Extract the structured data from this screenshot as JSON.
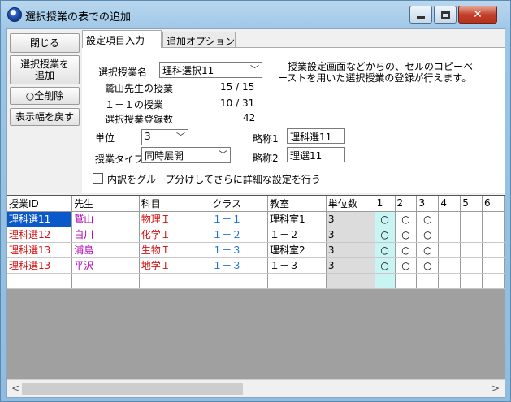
{
  "window": {
    "title": "選択授業の表での追加"
  },
  "left_buttons": {
    "close": "閉じる",
    "add_line1": "選択授業を",
    "add_line2": "追加",
    "delete_all": "○全削除",
    "reset_width": "表示幅を戻す"
  },
  "tabs": {
    "settings": "設定項目入力",
    "options": "追加オプション"
  },
  "form": {
    "course_name_label": "選択授業名",
    "course_name_value": "理科選択11",
    "teacher_label": "鷲山先生の授業",
    "teacher_value": "15 / 15",
    "class_label": "１－１の授業",
    "class_value": "10 / 31",
    "count_label": "選択授業登録数",
    "count_value": "42",
    "units_label": "単位",
    "units_value": "3",
    "type_label": "授業タイプ",
    "type_value": "同時展開",
    "abbr1_label": "略称1",
    "abbr1_value": "理科選11",
    "abbr2_label": "略称2",
    "abbr2_value": "理選11",
    "description": "　授業設定画面などからの、セルのコピーペーストを用いた選択授業の登録が行えます。",
    "group_checkbox_label": "内訳をグループ分けしてさらに詳細な設定を行う"
  },
  "table": {
    "headers": [
      "授業ID",
      "先生",
      "科目",
      "クラス",
      "教室",
      "単位数",
      "1",
      "2",
      "3",
      "4",
      "5",
      "6"
    ],
    "rows": [
      {
        "id": "理科選11",
        "teacher": "鷲山",
        "subject": "物理Ｉ",
        "cls": "１－１",
        "room": "理科室1",
        "units": "3",
        "s1": "○",
        "s2": "○",
        "s3": "○"
      },
      {
        "id": "理科選12",
        "teacher": "白川",
        "subject": "化学Ｉ",
        "cls": "１－２",
        "room": "１－２",
        "units": "3",
        "s1": "○",
        "s2": "○",
        "s3": "○"
      },
      {
        "id": "理科選13",
        "teacher": "浦島",
        "subject": "生物Ｉ",
        "cls": "１－３",
        "room": "理科室2",
        "units": "3",
        "s1": "○",
        "s2": "○",
        "s3": "○"
      },
      {
        "id": "理科選13",
        "teacher": "平沢",
        "subject": "地学Ｉ",
        "cls": "１－３",
        "room": "１－３",
        "units": "3",
        "s1": "○",
        "s2": "○",
        "s3": "○"
      }
    ]
  },
  "icons": {
    "app": "app-globe-icon",
    "minimize": "minimize-icon",
    "maximize": "maximize-icon",
    "close": "close-icon"
  }
}
